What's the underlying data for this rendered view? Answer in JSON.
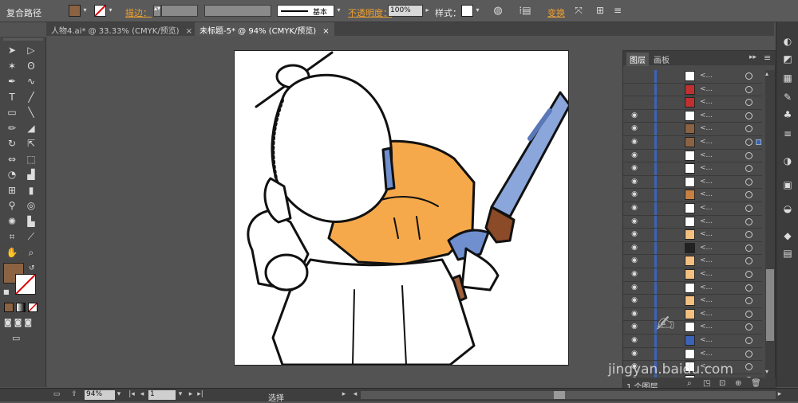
{
  "control_bar": {
    "object_type": "复合路径",
    "stroke_label": "描边：",
    "stroke_weight": "",
    "brush_label": "基本",
    "opacity_label": "不透明度：",
    "opacity_value": "100%",
    "style_label": "样式：",
    "transform_label": "变换",
    "fill_color": "#8b6343"
  },
  "tabs": [
    {
      "label": "人物4.ai* @ 33.33% (CMYK/预览)",
      "close": "×"
    },
    {
      "label": "未标题-5* @ 94% (CMYK/预览)",
      "close": "×"
    }
  ],
  "tools": {
    "icons": [
      "selection-arrow-icon",
      "direct-selection-icon",
      "magic-wand-icon",
      "lasso-icon",
      "pen-icon",
      "curvature-icon",
      "type-icon",
      "line-icon",
      "rectangle-icon",
      "paintbrush-icon",
      "pencil-icon",
      "eraser-icon",
      "rotate-icon",
      "scale-icon",
      "width-icon",
      "free-transform-icon",
      "shape-builder-icon",
      "perspective-icon",
      "mesh-icon",
      "gradient-icon",
      "eyedropper-icon",
      "blend-icon",
      "symbol-sprayer-icon",
      "graph-icon",
      "artboard-icon",
      "slice-icon",
      "hand-icon",
      "zoom-icon"
    ],
    "fill_color": "#8b6343",
    "stroke_color": "#ffffff"
  },
  "layers_panel": {
    "tab_layers": "图层",
    "tab_artboards": "画板",
    "rows": [
      {
        "visible": false,
        "thumb": "#ffffff",
        "name": "<..."
      },
      {
        "visible": false,
        "thumb": "#c03030",
        "name": "<..."
      },
      {
        "visible": false,
        "thumb": "#c03030",
        "name": "<..."
      },
      {
        "visible": true,
        "thumb": "#ffffff",
        "name": "<..."
      },
      {
        "visible": true,
        "thumb": "#8b6343",
        "name": "<..."
      },
      {
        "visible": true,
        "thumb": "#8b6343",
        "name": "<...",
        "selected": true
      },
      {
        "visible": true,
        "thumb": "#ffffff",
        "name": "<..."
      },
      {
        "visible": true,
        "thumb": "#ffffff",
        "name": "<..."
      },
      {
        "visible": true,
        "thumb": "#ffffff",
        "name": "<..."
      },
      {
        "visible": true,
        "thumb": "#c88040",
        "name": "<..."
      },
      {
        "visible": true,
        "thumb": "#ffffff",
        "name": "<..."
      },
      {
        "visible": true,
        "thumb": "#ffffff",
        "name": "<..."
      },
      {
        "visible": true,
        "thumb": "#f4c080",
        "name": "<..."
      },
      {
        "visible": true,
        "thumb": "#222222",
        "name": "<..."
      },
      {
        "visible": true,
        "thumb": "#f4c080",
        "name": "<..."
      },
      {
        "visible": true,
        "thumb": "#f4c080",
        "name": "<..."
      },
      {
        "visible": true,
        "thumb": "#ffffff",
        "name": "<..."
      },
      {
        "visible": true,
        "thumb": "#f4c080",
        "name": "<..."
      },
      {
        "visible": true,
        "thumb": "#f4c080",
        "name": "<..."
      },
      {
        "visible": true,
        "thumb": "#ffffff",
        "name": "<..."
      },
      {
        "visible": true,
        "thumb": "#3c63b8",
        "name": "<..."
      },
      {
        "visible": true,
        "thumb": "#ffffff",
        "name": "<..."
      },
      {
        "visible": true,
        "thumb": "#ffffff",
        "name": "<..."
      },
      {
        "visible": true,
        "thumb": "#ffffff",
        "name": "<..."
      }
    ],
    "footer_label": "1 个图层"
  },
  "status_bar": {
    "zoom": "94%",
    "artboard_num": "1",
    "tool_status": "选择"
  },
  "watermark": "jingyan.baidu.com"
}
